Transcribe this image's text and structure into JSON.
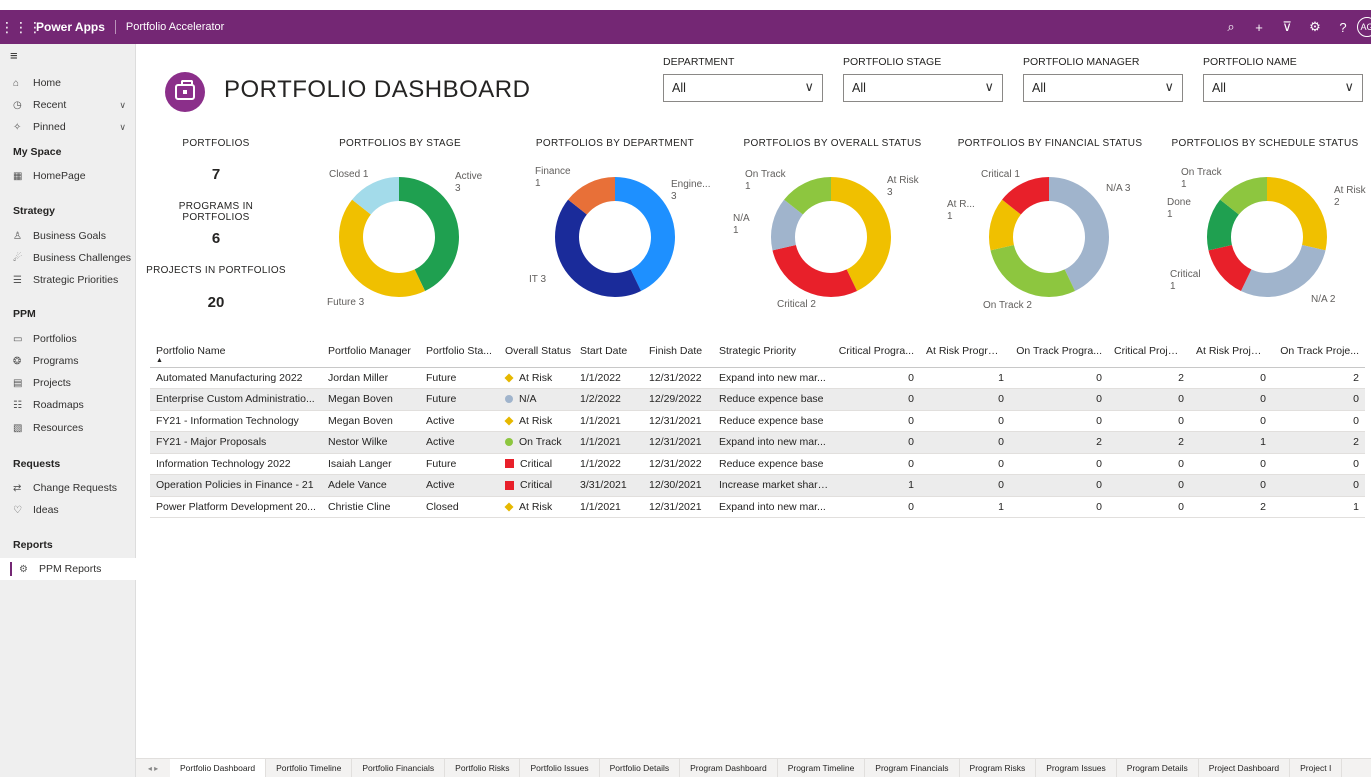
{
  "topbar": {
    "app_name": "Power Apps",
    "breadcrumb": "Portfolio Accelerator",
    "avatar": "AG"
  },
  "sidebar": {
    "items": [
      {
        "label": "Home",
        "icon": "home-icon"
      },
      {
        "label": "Recent",
        "icon": "clock-icon"
      },
      {
        "label": "Pinned",
        "icon": "pin-icon"
      }
    ],
    "groups": [
      {
        "title": "My Space",
        "items": [
          "HomePage"
        ]
      },
      {
        "title": "Strategy",
        "items": [
          "Business Goals",
          "Business Challenges",
          "Strategic Priorities"
        ]
      },
      {
        "title": "PPM",
        "items": [
          "Portfolios",
          "Programs",
          "Projects",
          "Roadmaps",
          "Resources"
        ]
      },
      {
        "title": "Requests",
        "items": [
          "Change Requests",
          "Ideas"
        ]
      },
      {
        "title": "Reports",
        "items": [
          "PPM Reports"
        ]
      }
    ]
  },
  "header": {
    "title": "PORTFOLIO DASHBOARD"
  },
  "filters": [
    {
      "label": "DEPARTMENT",
      "value": "All"
    },
    {
      "label": "PORTFOLIO STAGE",
      "value": "All"
    },
    {
      "label": "PORTFOLIO MANAGER",
      "value": "All"
    },
    {
      "label": "PORTFOLIO NAME",
      "value": "All"
    }
  ],
  "kpis": [
    {
      "label": "PORTFOLIOS",
      "value": "7"
    },
    {
      "label": "PROGRAMS IN PORTFOLIOS",
      "value": "6"
    },
    {
      "label": "PROJECTS IN PORTFOLIOS",
      "value": "20"
    }
  ],
  "chart_data": [
    {
      "type": "pie",
      "title": "PORTFOLIOS BY STAGE",
      "slices": [
        {
          "label": "Active",
          "value": 3,
          "color": "#1fa050",
          "text": "Active\n3"
        },
        {
          "label": "Future",
          "value": 3,
          "color": "#f0c000",
          "text": "Future 3"
        },
        {
          "label": "Closed",
          "value": 1,
          "color": "#a3dbea",
          "text": "Closed 1"
        }
      ]
    },
    {
      "type": "pie",
      "title": "PORTFOLIOS BY DEPARTMENT",
      "slices": [
        {
          "label": "Engine...",
          "value": 3,
          "color": "#1e90ff",
          "text": "Engine...\n3"
        },
        {
          "label": "IT",
          "value": 3,
          "color": "#1a2b9a",
          "text": "IT 3"
        },
        {
          "label": "Finance",
          "value": 1,
          "color": "#e87038",
          "text": "Finance\n1"
        }
      ]
    },
    {
      "type": "pie",
      "title": "PORTFOLIOS BY OVERALL STATUS",
      "slices": [
        {
          "label": "At Risk",
          "value": 3,
          "color": "#f0c000",
          "text": "At Risk\n3"
        },
        {
          "label": "Critical",
          "value": 2,
          "color": "#e8202a",
          "text": "Critical 2"
        },
        {
          "label": "N/A",
          "value": 1,
          "color": "#a0b4cc",
          "text": "N/A\n1"
        },
        {
          "label": "On Track",
          "value": 1,
          "color": "#8dc63f",
          "text": "On Track\n1"
        }
      ]
    },
    {
      "type": "pie",
      "title": "PORTFOLIOS BY FINANCIAL STATUS",
      "slices": [
        {
          "label": "N/A",
          "value": 3,
          "color": "#a0b4cc",
          "text": "N/A 3"
        },
        {
          "label": "On Track",
          "value": 2,
          "color": "#8dc63f",
          "text": "On Track 2"
        },
        {
          "label": "At R...",
          "value": 1,
          "color": "#f0c000",
          "text": "At R...\n1"
        },
        {
          "label": "Critical",
          "value": 1,
          "color": "#e8202a",
          "text": "Critical 1"
        }
      ]
    },
    {
      "type": "pie",
      "title": "PORTFOLIOS BY SCHEDULE STATUS",
      "slices": [
        {
          "label": "At Risk",
          "value": 2,
          "color": "#f0c000",
          "text": "At Risk\n2"
        },
        {
          "label": "N/A",
          "value": 2,
          "color": "#a0b4cc",
          "text": "N/A 2"
        },
        {
          "label": "Critical",
          "value": 1,
          "color": "#e8202a",
          "text": "Critical\n1"
        },
        {
          "label": "Done",
          "value": 1,
          "color": "#1fa050",
          "text": "Done\n1"
        },
        {
          "label": "On Track",
          "value": 1,
          "color": "#8dc63f",
          "text": "On Track\n1"
        }
      ]
    }
  ],
  "table": {
    "columns": [
      "Portfolio Name",
      "Portfolio Manager",
      "Portfolio Sta...",
      "Overall Status",
      "Start Date",
      "Finish Date",
      "Strategic Priority",
      "Critical Progra...",
      "At Risk Programs",
      "On Track Progra...",
      "Critical Projects",
      "At Risk Projects",
      "On Track Proje..."
    ],
    "rows": [
      [
        "Automated Manufacturing 2022",
        "Jordan Miller",
        "Future",
        "At Risk",
        "1/1/2022",
        "12/31/2022",
        "Expand into new mar...",
        "0",
        "1",
        "0",
        "2",
        "0",
        "2"
      ],
      [
        "Enterprise Custom Administratio...",
        "Megan Boven",
        "Future",
        "N/A",
        "1/2/2022",
        "12/29/2022",
        "Reduce expence base",
        "0",
        "0",
        "0",
        "0",
        "0",
        "0"
      ],
      [
        "FY21 - Information Technology",
        "Megan Boven",
        "Active",
        "At Risk",
        "1/1/2021",
        "12/31/2021",
        "Reduce expence base",
        "0",
        "0",
        "0",
        "0",
        "0",
        "0"
      ],
      [
        "FY21 - Major Proposals",
        "Nestor Wilke",
        "Active",
        "On Track",
        "1/1/2021",
        "12/31/2021",
        "Expand into new mar...",
        "0",
        "0",
        "2",
        "2",
        "1",
        "2"
      ],
      [
        "Information Technology 2022",
        "Isaiah Langer",
        "Future",
        "Critical",
        "1/1/2022",
        "12/31/2022",
        "Reduce expence base",
        "0",
        "0",
        "0",
        "0",
        "0",
        "0"
      ],
      [
        "Operation Policies in Finance - 21",
        "Adele Vance",
        "Active",
        "Critical",
        "3/31/2021",
        "12/30/2021",
        "Increase market share...",
        "1",
        "0",
        "0",
        "0",
        "0",
        "0"
      ],
      [
        "Power Platform Development 20...",
        "Christie Cline",
        "Closed",
        "At Risk",
        "1/1/2021",
        "12/31/2021",
        "Expand into new mar...",
        "0",
        "1",
        "0",
        "0",
        "2",
        "1"
      ]
    ]
  },
  "tabs": [
    "Portfolio Dashboard",
    "Portfolio Timeline",
    "Portfolio Financials",
    "Portfolio Risks",
    "Portfolio Issues",
    "Portfolio Details",
    "Program Dashboard",
    "Program Timeline",
    "Program Financials",
    "Program Risks",
    "Program Issues",
    "Program Details",
    "Project Dashboard",
    "Project I"
  ]
}
